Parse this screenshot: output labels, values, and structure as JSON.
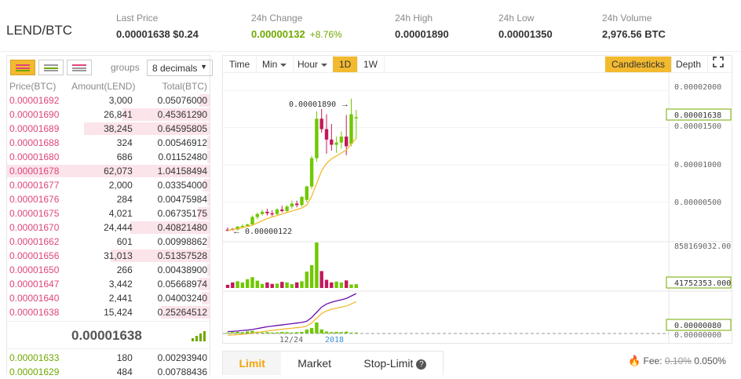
{
  "header": {
    "pair": "LEND/BTC",
    "stats": [
      {
        "label": "Last Price",
        "value": "0.00001638 $0.24"
      },
      {
        "label": "24h Change",
        "value": "0.00000132",
        "extra": "+8.76%"
      },
      {
        "label": "24h High",
        "value": "0.00001890"
      },
      {
        "label": "24h Low",
        "value": "0.00001350"
      },
      {
        "label": "24h Volume",
        "value": "2,976.56 BTC"
      }
    ]
  },
  "orderbook": {
    "groups_label": "groups",
    "decimals": "8 decimals",
    "headers": [
      "Price(BTC)",
      "Amount(LEND)",
      "Total(BTC)"
    ],
    "asks": [
      {
        "price": "0.00001692",
        "amount": "3,000",
        "total": "0.05076000",
        "depth": 0.05
      },
      {
        "price": "0.00001690",
        "amount": "26,841",
        "total": "0.45361290",
        "depth": 0.43
      },
      {
        "price": "0.00001689",
        "amount": "38,245",
        "total": "0.64595805",
        "depth": 0.62
      },
      {
        "price": "0.00001688",
        "amount": "324",
        "total": "0.00546912",
        "depth": 0.01
      },
      {
        "price": "0.00001680",
        "amount": "686",
        "total": "0.01152480",
        "depth": 0.01
      },
      {
        "price": "0.00001678",
        "amount": "62,073",
        "total": "1.04158494",
        "depth": 1.0
      },
      {
        "price": "0.00001677",
        "amount": "2,000",
        "total": "0.03354000",
        "depth": 0.03
      },
      {
        "price": "0.00001676",
        "amount": "284",
        "total": "0.00475984",
        "depth": 0.01
      },
      {
        "price": "0.00001675",
        "amount": "4,021",
        "total": "0.06735175",
        "depth": 0.06
      },
      {
        "price": "0.00001670",
        "amount": "24,444",
        "total": "0.40821480",
        "depth": 0.39
      },
      {
        "price": "0.00001662",
        "amount": "601",
        "total": "0.00998862",
        "depth": 0.01
      },
      {
        "price": "0.00001656",
        "amount": "31,013",
        "total": "0.51357528",
        "depth": 0.49
      },
      {
        "price": "0.00001650",
        "amount": "266",
        "total": "0.00438900",
        "depth": 0.01
      },
      {
        "price": "0.00001647",
        "amount": "3,442",
        "total": "0.05668974",
        "depth": 0.05
      },
      {
        "price": "0.00001640",
        "amount": "2,441",
        "total": "0.04003240",
        "depth": 0.04
      },
      {
        "price": "0.00001638",
        "amount": "15,424",
        "total": "0.25264512",
        "depth": 0.24
      }
    ],
    "last_price": "0.00001638",
    "bids": [
      {
        "price": "0.00001633",
        "amount": "180",
        "total": "0.00293940"
      },
      {
        "price": "0.00001629",
        "amount": "484",
        "total": "0.00788436"
      }
    ]
  },
  "toolbar": {
    "time": "Time",
    "min": "Min",
    "hour": "Hour",
    "d1": "1D",
    "w1": "1W",
    "candles": "Candlesticks",
    "depth": "Depth"
  },
  "chart_data": {
    "type": "candlestick",
    "price_axis_ticks": [
      "0.00002000",
      "0.00001500",
      "0.00001000",
      "0.00000500"
    ],
    "volume_axis_label": "858169032.00",
    "current_price_tag": "0.00001638",
    "volume_tag": "41752353.000",
    "indicator_tag": "0.00000080",
    "indicator_axis": "0.00000000",
    "high_annotation": "0.00001890",
    "low_annotation": "0.00000122",
    "x_labels": [
      "12/24",
      "2018"
    ],
    "ylim": [
      0,
      2.15e-05
    ],
    "candles": [
      {
        "o": 1.3e-06,
        "h": 1.6e-06,
        "l": 1.1e-06,
        "c": 1.2e-06
      },
      {
        "o": 1.4e-06,
        "h": 1.5e-06,
        "l": 1.2e-06,
        "c": 1.3e-06
      },
      {
        "o": 1.3e-06,
        "h": 1.8e-06,
        "l": 1.2e-06,
        "c": 1.7e-06
      },
      {
        "o": 1.7e-06,
        "h": 2e-06,
        "l": 1.5e-06,
        "c": 1.8e-06
      },
      {
        "o": 1.8e-06,
        "h": 2.1e-06,
        "l": 1.7e-06,
        "c": 2e-06
      },
      {
        "o": 2e-06,
        "h": 3.2e-06,
        "l": 1.9e-06,
        "c": 3e-06
      },
      {
        "o": 3e-06,
        "h": 3.6e-06,
        "l": 2.7e-06,
        "c": 3.4e-06
      },
      {
        "o": 3.4e-06,
        "h": 4e-06,
        "l": 3.2e-06,
        "c": 3.7e-06
      },
      {
        "o": 3.7e-06,
        "h": 4.1e-06,
        "l": 3.2e-06,
        "c": 3.5e-06
      },
      {
        "o": 3.5e-06,
        "h": 3.9e-06,
        "l": 3.1e-06,
        "c": 3.4e-06
      },
      {
        "o": 3.4e-06,
        "h": 4.2e-06,
        "l": 3.3e-06,
        "c": 4e-06
      },
      {
        "o": 4e-06,
        "h": 4.5e-06,
        "l": 3.6e-06,
        "c": 3.8e-06
      },
      {
        "o": 3.8e-06,
        "h": 4.6e-06,
        "l": 3.6e-06,
        "c": 4.4e-06
      },
      {
        "o": 4.4e-06,
        "h": 5.2e-06,
        "l": 4.1e-06,
        "c": 4.8e-06
      },
      {
        "o": 4.8e-06,
        "h": 5.2e-06,
        "l": 4.3e-06,
        "c": 4.6e-06
      },
      {
        "o": 4.6e-06,
        "h": 5.8e-06,
        "l": 4.4e-06,
        "c": 5.7e-06
      },
      {
        "o": 5.3e-06,
        "h": 7.2e-06,
        "l": 5e-06,
        "c": 7.1e-06
      },
      {
        "o": 7.1e-06,
        "h": 1.12e-05,
        "l": 6.8e-06,
        "c": 1.09e-05
      },
      {
        "o": 1.09e-05,
        "h": 1.72e-05,
        "l": 1.04e-05,
        "c": 1.62e-05
      },
      {
        "o": 1.62e-05,
        "h": 1.75e-05,
        "l": 1.43e-05,
        "c": 1.48e-05
      },
      {
        "o": 1.48e-05,
        "h": 1.68e-05,
        "l": 1.15e-05,
        "c": 1.34e-05
      },
      {
        "o": 1.34e-05,
        "h": 1.55e-05,
        "l": 1.19e-05,
        "c": 1.27e-05
      },
      {
        "o": 1.27e-05,
        "h": 1.38e-05,
        "l": 1.16e-05,
        "c": 1.3e-05
      },
      {
        "o": 1.3e-05,
        "h": 1.45e-05,
        "l": 1.22e-05,
        "c": 1.38e-05
      },
      {
        "o": 1.38e-05,
        "h": 1.67e-05,
        "l": 1.13e-05,
        "c": 1.25e-05
      },
      {
        "o": 1.28e-05,
        "h": 1.89e-05,
        "l": 1.25e-05,
        "c": 1.68e-05
      },
      {
        "o": 1.64e-05,
        "h": 1.74e-05,
        "l": 1.35e-05,
        "c": 1.64e-05
      }
    ],
    "volumes": [
      1.1,
      1.9,
      2.3,
      1.9,
      3.0,
      3.7,
      2.5,
      1.4,
      1.9,
      1.4,
      1.5,
      2.1,
      1.9,
      1.3,
      1.9,
      2.3,
      5.6,
      7.8,
      15.6,
      5.8,
      2.8,
      1.9,
      2.2,
      1.9,
      2.6,
      1.2,
      1.3
    ],
    "ma_price": [
      1.2e-06,
      1.3e-06,
      1.4e-06,
      1.6e-06,
      1.7e-06,
      1.9e-06,
      2.2e-06,
      2.5e-06,
      2.8e-06,
      3e-06,
      3.2e-06,
      3.4e-06,
      3.6e-06,
      3.8e-06,
      4e-06,
      4.2e-06,
      4.6e-06,
      5.8e-06,
      7.5e-06,
      9.2e-06,
      1.02e-05,
      1.08e-05,
      1.12e-05,
      1.16e-05,
      1.2e-05,
      1.28e-05,
      1.36e-05
    ]
  },
  "order_tabs": {
    "limit": "Limit",
    "market": "Market",
    "stop": "Stop-Limit"
  },
  "fee": {
    "label": "Fee:",
    "old": "0.10%",
    "new": "0.050%"
  }
}
